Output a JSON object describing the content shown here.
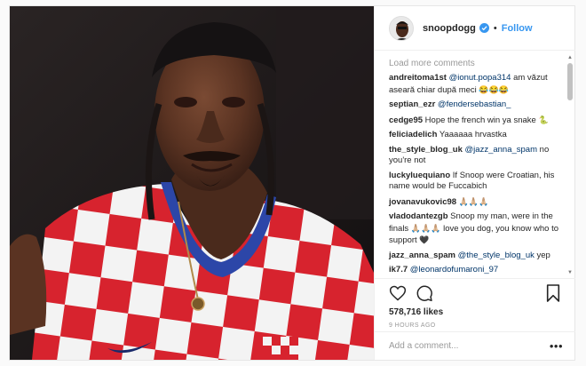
{
  "post": {
    "username": "snoopdogg",
    "follow_label": "Follow",
    "separator": "•"
  },
  "comments_panel": {
    "load_more": "Load more comments",
    "items": [
      {
        "user": "andreitoma1st",
        "mention": "@ionut.popa314",
        "text": " am văzut aseară chiar după meci",
        "emoji": "😂😂😂"
      },
      {
        "user": "septian_ezr",
        "mention": "@fendersebastian_",
        "text": "",
        "emoji": ""
      },
      {
        "user": "cedge95",
        "mention": "",
        "text": "Hope the french win ya snake ",
        "emoji": "🐍"
      },
      {
        "user": "feliciadelich",
        "mention": "",
        "text": "Yaaaaaa hrvastka",
        "emoji": ""
      },
      {
        "user": "the_style_blog_uk",
        "mention": "@jazz_anna_spam",
        "text": " no you're not",
        "emoji": ""
      },
      {
        "user": "luckyluequiano",
        "mention": "",
        "text": "If Snoop were Croatian, his name would be Fuccabich",
        "emoji": ""
      },
      {
        "user": "jovanavukovic98",
        "mention": "",
        "text": "",
        "emoji": "🙏🏼🙏🏼🙏🏼"
      },
      {
        "user": "vladodantezgb",
        "mention": "",
        "text": "Snoop my man, were in the finals ",
        "emoji": "🙏🏼🙏🏼🙏🏼",
        "text2": " love you dog, you know who to support ",
        "emoji2": "🖤"
      },
      {
        "user": "jazz_anna_spam",
        "mention": "@the_style_blog_uk",
        "text": " yep",
        "emoji": ""
      },
      {
        "user": "ik7.7",
        "mention": "@leonardofumaroni_97",
        "text": "",
        "emoji": ""
      }
    ]
  },
  "actions": {
    "like_icon": "heart-icon",
    "comment_icon": "comment-icon",
    "save_icon": "bookmark-icon",
    "likes": "578,716 likes",
    "time": "9 HOURS AGO"
  },
  "add_comment": {
    "placeholder": "Add a comment...",
    "more_label": "•••"
  },
  "colors": {
    "link": "#3897f0",
    "text": "#262626",
    "muted": "#999999",
    "mention": "#003569",
    "verified": "#3897f0"
  }
}
